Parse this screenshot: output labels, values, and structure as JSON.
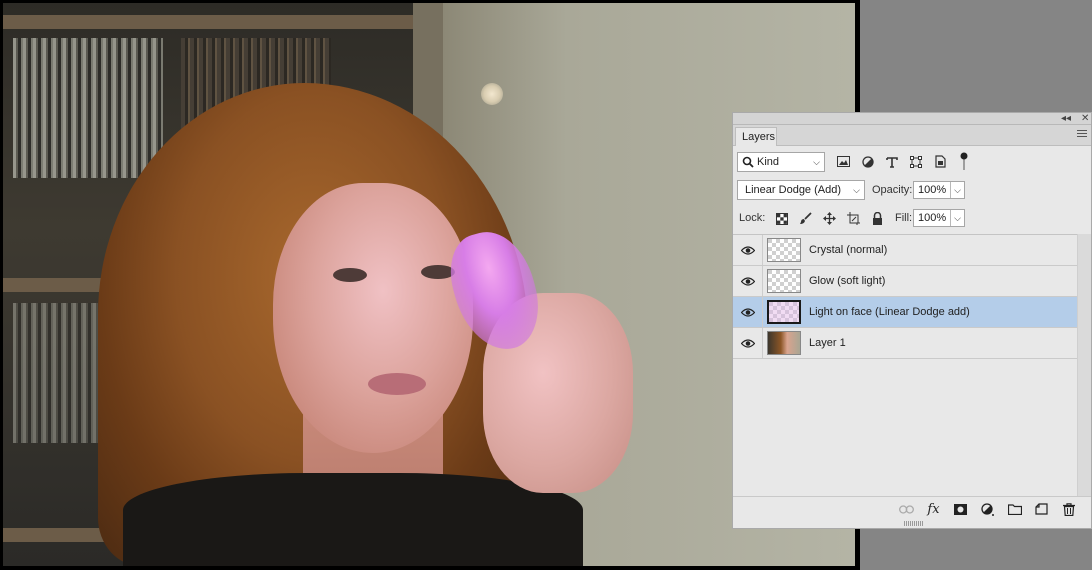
{
  "panel": {
    "tab_label": "Layers",
    "strip": {
      "collapse_glyph": "◂◂",
      "close_glyph": "✕"
    },
    "filter": {
      "kind_label": "Kind",
      "icons": [
        "image-filter-icon",
        "adjustment-filter-icon",
        "type-filter-icon",
        "shape-filter-icon",
        "smart-object-filter-icon"
      ]
    },
    "blend": {
      "mode": "Linear Dodge (Add)",
      "opacity_label": "Opacity:",
      "opacity_value": "100%"
    },
    "lock": {
      "label": "Lock:",
      "fill_label": "Fill:",
      "fill_value": "100%",
      "icons": [
        "lock-transparent-icon",
        "lock-paint-icon",
        "lock-position-icon",
        "lock-artboard-icon",
        "lock-all-icon"
      ]
    },
    "layers": [
      {
        "name": "Crystal (normal)",
        "selected": false,
        "thumb": "transparent"
      },
      {
        "name": "Glow (soft light)",
        "selected": false,
        "thumb": "transparent"
      },
      {
        "name": "Light on face (Linear Dodge add)",
        "selected": true,
        "thumb": "transparent-pink"
      },
      {
        "name": "Layer 1",
        "selected": false,
        "thumb": "photo"
      }
    ],
    "footer_icons": [
      "link-layers-icon",
      "fx-icon",
      "add-mask-icon",
      "adjustment-layer-icon",
      "group-folder-icon",
      "new-layer-icon",
      "trash-icon"
    ],
    "fx_label": "fx"
  },
  "colors": {
    "selected_row": "#b4cde9",
    "panel_bg": "#e8e8e8",
    "workspace": "#858585"
  }
}
